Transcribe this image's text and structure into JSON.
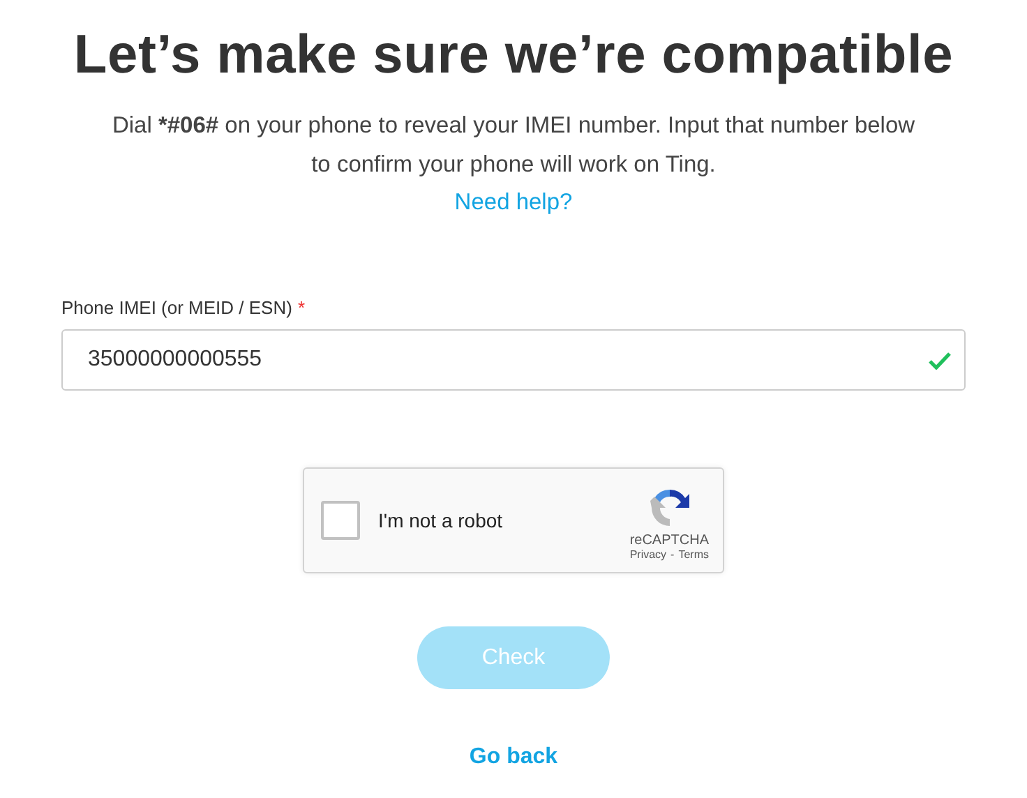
{
  "title": "Let’s make sure we’re compatible",
  "intro": "Dial ***#06#** on your phone to reveal your IMEI number. Input that number below to confirm your phone will work on Ting.",
  "help_link": "Need help?",
  "imei_field": {
    "label": "Phone IMEI (or MEID / ESN)",
    "required_mark": "*",
    "value": "35000000000555",
    "valid": true
  },
  "captcha": {
    "label": "I'm not a robot",
    "checked": false,
    "brand": "reCAPTCHA",
    "privacy": "Privacy",
    "separator": "-",
    "terms": "Terms"
  },
  "check_button": {
    "label": "Check",
    "disabled": true
  },
  "back_link": "Go back"
}
